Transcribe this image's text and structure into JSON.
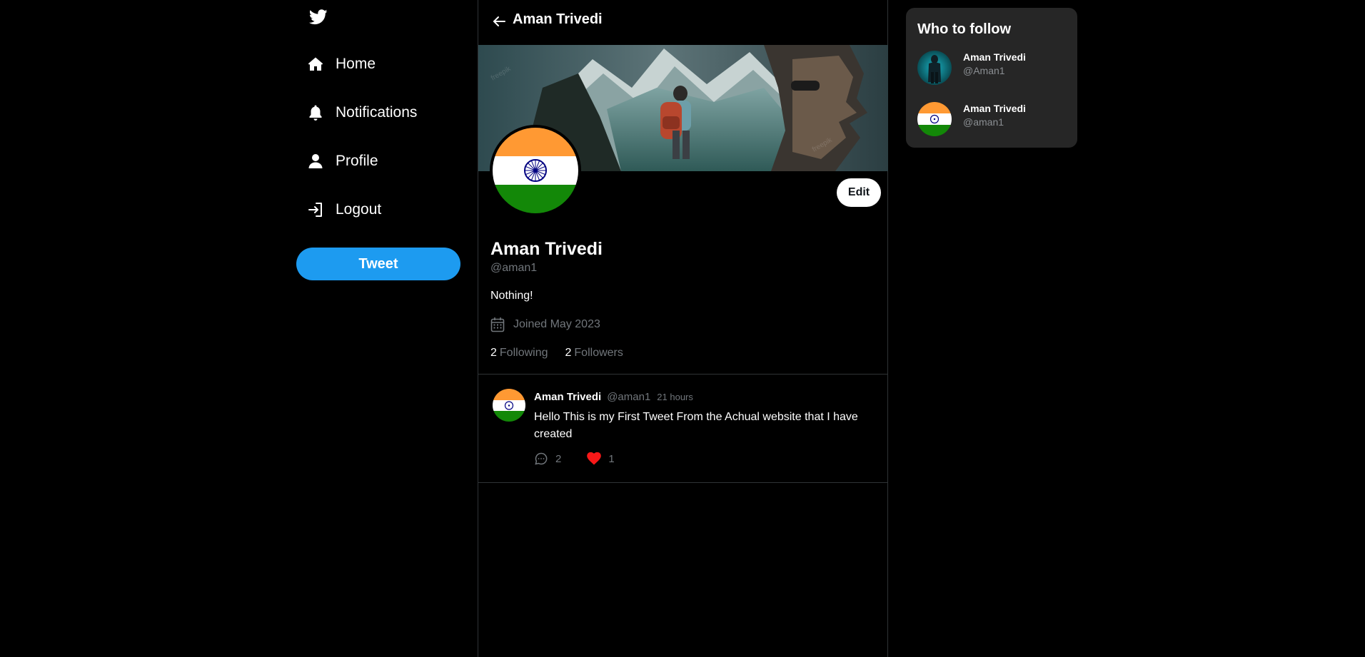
{
  "sidebar": {
    "logo_icon": "twitter-bird-icon",
    "items": [
      {
        "label": "Home",
        "icon": "home-icon"
      },
      {
        "label": "Notifications",
        "icon": "bell-icon"
      },
      {
        "label": "Profile",
        "icon": "user-icon"
      },
      {
        "label": "Logout",
        "icon": "logout-icon"
      }
    ],
    "tweet_button": "Tweet"
  },
  "header": {
    "back_icon": "arrow-left-icon",
    "title": "Aman Trivedi"
  },
  "profile": {
    "name": "Aman Trivedi",
    "handle": "@aman1",
    "bio": "Nothing!",
    "joined": "Joined May 2023",
    "edit_label": "Edit",
    "following_count": "2",
    "following_label": "Following",
    "followers_count": "2",
    "followers_label": "Followers"
  },
  "tweets": [
    {
      "name": "Aman Trivedi",
      "handle": "@aman1",
      "time": "21 hours",
      "text": "Hello This is my First Tweet From the Achual website that I have created",
      "replies": "2",
      "likes": "1"
    }
  ],
  "who_to_follow": {
    "title": "Who to follow",
    "users": [
      {
        "name": "Aman Trivedi",
        "handle": "@Aman1"
      },
      {
        "name": "Aman Trivedi",
        "handle": "@aman1"
      }
    ]
  },
  "colors": {
    "background": "#000000",
    "accent": "#1d9bf0",
    "muted_text": "#71767b",
    "widget_bg": "#262626",
    "like_red": "#f91818",
    "flag_saffron": "#ff9933",
    "flag_green": "#138808",
    "chakra_blue": "#000080"
  }
}
